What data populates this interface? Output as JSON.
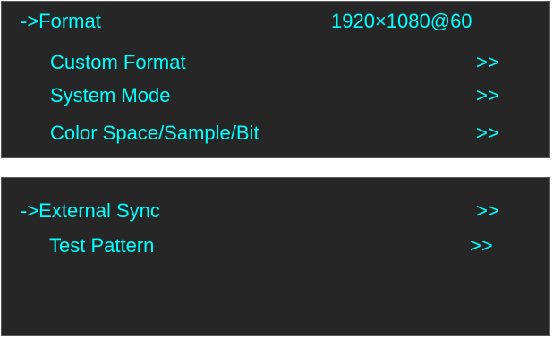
{
  "menu_top": {
    "items": [
      {
        "label": "->Format",
        "value": "1920×1080@60"
      },
      {
        "label": "Custom Format",
        "value": ">>"
      },
      {
        "label": "System Mode",
        "value": ">>"
      },
      {
        "label": "Color Space/Sample/Bit",
        "value": ">>"
      }
    ]
  },
  "menu_bottom": {
    "items": [
      {
        "label": "->External Sync",
        "value": ">>"
      },
      {
        "label": "Test Pattern",
        "value": ">>"
      }
    ]
  },
  "colors": {
    "background": "#262626",
    "text": "#00ffff",
    "border": "#5a5a5a"
  }
}
